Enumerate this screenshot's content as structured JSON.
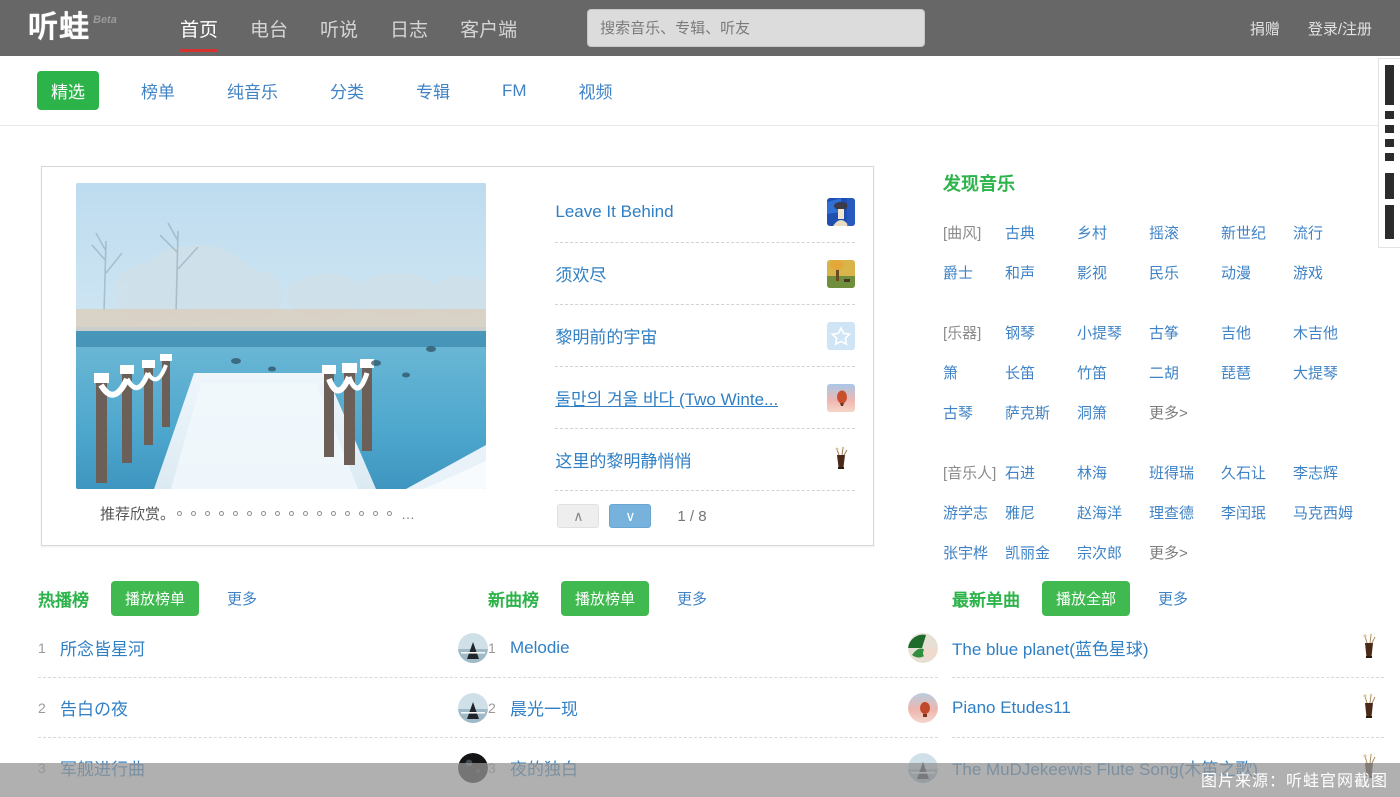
{
  "header": {
    "logo_text": "听蛙",
    "logo_badge": "Beta",
    "nav": [
      {
        "label": "首页",
        "active": true
      },
      {
        "label": "电台",
        "active": false
      },
      {
        "label": "听说",
        "active": false
      },
      {
        "label": "日志",
        "active": false
      },
      {
        "label": "客户端",
        "active": false
      }
    ],
    "search": {
      "value": "",
      "placeholder": "搜索音乐、专辑、听友"
    },
    "right_links": [
      "捐赠",
      "登录/注册"
    ],
    "bg_color": "#676767",
    "active_underline_color": "#d7332e"
  },
  "subnav": {
    "items": [
      {
        "label": "精选",
        "active": true
      },
      {
        "label": "榜单",
        "active": false
      },
      {
        "label": "纯音乐",
        "active": false
      },
      {
        "label": "分类",
        "active": false
      },
      {
        "label": "专辑",
        "active": false
      },
      {
        "label": "FM",
        "active": false
      },
      {
        "label": "视频",
        "active": false
      }
    ],
    "active_color": "#2cb34a",
    "link_color": "#3f83c6"
  },
  "carousel": {
    "caption": "推荐欣赏。",
    "dot_count": 16,
    "ellipsis": "…",
    "image_alt": "雪景木桥冰湖"
  },
  "playlist": {
    "items": [
      {
        "title": "Leave It Behind",
        "thumb": "winter-blue-illustration",
        "underlined": false
      },
      {
        "title": "须欢尽",
        "thumb": "autumn-tree",
        "underlined": false
      },
      {
        "title": "黎明前的宇宙",
        "thumb": "star-icon",
        "underlined": false
      },
      {
        "title": "둘만의 겨울 바다 (Two Winte...",
        "thumb": "hot-air-balloon",
        "underlined": true
      },
      {
        "title": "这里的黎明静悄悄",
        "thumb": "drink-glass",
        "underlined": false
      }
    ],
    "pager": {
      "up": "∧",
      "down": "∨",
      "count": "1 / 8"
    }
  },
  "discover": {
    "title": "发现音乐",
    "groups": [
      {
        "label": "[曲风]",
        "rows": [
          [
            "古典",
            "乡村",
            "摇滚",
            "新世纪",
            "流行"
          ],
          [
            "爵士",
            "和声",
            "影视",
            "民乐",
            "动漫",
            "游戏"
          ]
        ]
      },
      {
        "label": "[乐器]",
        "rows": [
          [
            "钢琴",
            "小提琴",
            "古筝",
            "吉他",
            "木吉他"
          ],
          [
            "箫",
            "长笛",
            "竹笛",
            "二胡",
            "琵琶",
            "大提琴"
          ],
          [
            "古琴",
            "萨克斯",
            "洞箫",
            "更多>"
          ]
        ]
      },
      {
        "label": "[音乐人]",
        "rows": [
          [
            "石进",
            "林海",
            "班得瑞",
            "久石让",
            "李志辉"
          ],
          [
            "游学志",
            "雅尼",
            "赵海洋",
            "理查德",
            "李闰珉",
            "马克西姆"
          ],
          [
            "张宇桦",
            "凯丽金",
            "宗次郎",
            "更多>"
          ]
        ]
      }
    ]
  },
  "columns": [
    {
      "title": "热播榜",
      "button": "播放榜单",
      "more": "更多",
      "numbered": true,
      "songs": [
        {
          "rank": "1",
          "name": "所念皆星河",
          "avatar": "mountain-silhouette"
        },
        {
          "rank": "2",
          "name": "告白の夜",
          "avatar": "mountain-silhouette"
        },
        {
          "rank": "3",
          "name": "军舰进行曲",
          "avatar": "dark-sphere"
        }
      ]
    },
    {
      "title": "新曲榜",
      "button": "播放榜单",
      "more": "更多",
      "numbered": true,
      "songs": [
        {
          "rank": "1",
          "name": "Melodie",
          "avatar": "green-leaf"
        },
        {
          "rank": "2",
          "name": "晨光一现",
          "avatar": "pink-sunrise"
        },
        {
          "rank": "3",
          "name": "夜的独白",
          "avatar": "mountain-silhouette"
        }
      ]
    },
    {
      "title": "最新单曲",
      "button": "播放全部",
      "more": "更多",
      "numbered": false,
      "songs": [
        {
          "rank": "",
          "name": "The blue planet(蓝色星球)",
          "avatar": "drink-glass"
        },
        {
          "rank": "",
          "name": "Piano Etudes11",
          "avatar": "drink-glass"
        },
        {
          "rank": "",
          "name": "The MuDJekeewis Flute Song(木笛之歌)",
          "avatar": "drink-glass"
        }
      ]
    }
  ],
  "watermark": "图片来源：听蛙官网截图"
}
